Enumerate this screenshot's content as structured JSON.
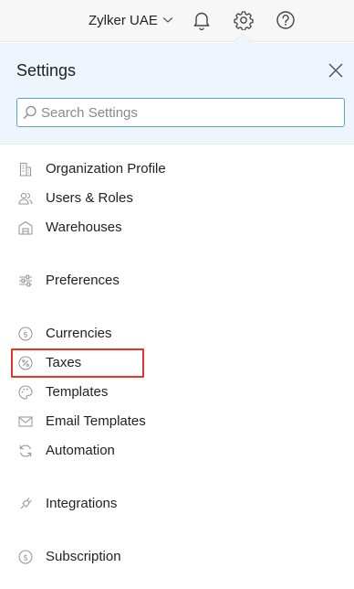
{
  "topbar": {
    "org_name": "Zylker UAE",
    "icons": [
      "chevron-down-icon",
      "bell-icon",
      "gear-icon",
      "help-icon"
    ]
  },
  "settings": {
    "title": "Settings",
    "close_icon": "close-icon",
    "search": {
      "placeholder": "Search Settings",
      "value": ""
    }
  },
  "menu": {
    "items": [
      {
        "label": "Organization Profile",
        "icon": "building-icon"
      },
      {
        "label": "Users & Roles",
        "icon": "users-icon"
      },
      {
        "label": "Warehouses",
        "icon": "warehouse-icon"
      },
      {
        "label": "Preferences",
        "icon": "sliders-icon"
      },
      {
        "label": "Currencies",
        "icon": "currency-icon"
      },
      {
        "label": "Taxes",
        "icon": "percent-icon",
        "highlighted": true
      },
      {
        "label": "Templates",
        "icon": "palette-icon"
      },
      {
        "label": "Email Templates",
        "icon": "mail-icon"
      },
      {
        "label": "Automation",
        "icon": "refresh-icon"
      },
      {
        "label": "Integrations",
        "icon": "plug-icon"
      },
      {
        "label": "Subscription",
        "icon": "subscription-icon"
      }
    ]
  },
  "colors": {
    "header_bg": "#eef5fd",
    "search_border": "#5aa1dc",
    "highlight_border": "#e8361f",
    "icon_gray": "#9a9a9a"
  }
}
